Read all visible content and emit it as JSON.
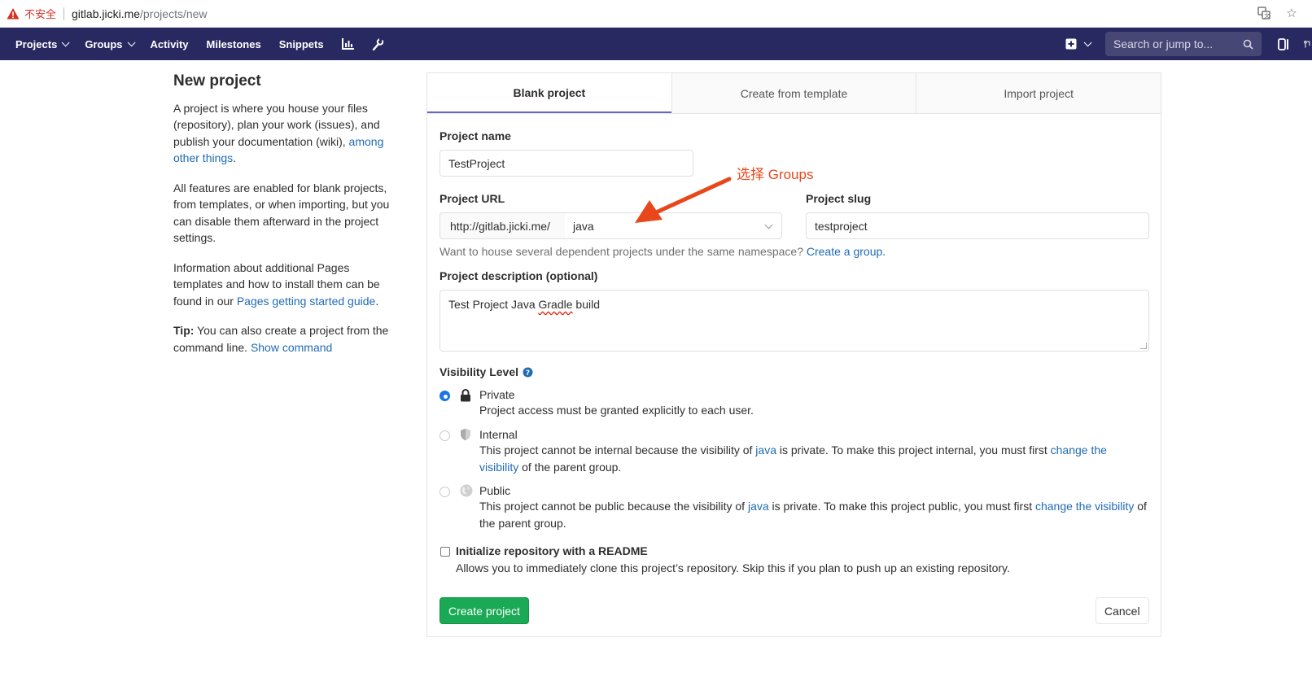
{
  "browser": {
    "insecure_label": "不安全",
    "url_host": "gitlab.jicki.me",
    "url_path": "/projects/new"
  },
  "nav": {
    "items": [
      "Projects",
      "Groups",
      "Activity",
      "Milestones",
      "Snippets"
    ],
    "search_placeholder": "Search or jump to..."
  },
  "sidebar": {
    "title": "New project",
    "para1_text": "A project is where you house your files (repository), plan your work (issues), and publish your documentation (wiki), ",
    "para1_link": "among other things",
    "para1_end": ".",
    "para2": "All features are enabled for blank projects, from templates, or when importing, but you can disable them afterward in the project settings.",
    "para3_text": "Information about additional Pages templates and how to install them can be found in our ",
    "para3_link": "Pages getting started guide",
    "para3_end": ".",
    "tip_label": "Tip:",
    "tip_text": " You can also create a project from the command line. ",
    "tip_link": "Show command"
  },
  "tabs": [
    "Blank project",
    "Create from template",
    "Import project"
  ],
  "form": {
    "project_name_label": "Project name",
    "project_name_value": "TestProject",
    "project_url_label": "Project URL",
    "url_prefix": "http://gitlab.jicki.me/",
    "namespace_value": "java",
    "project_slug_label": "Project slug",
    "project_slug_value": "testproject",
    "namespace_help": "Want to house several dependent projects under the same namespace?",
    "namespace_help_link": "Create a group.",
    "description_label": "Project description (optional)",
    "description_value_a": "Test Project  Java ",
    "description_value_b": "Gradle",
    "description_value_c": " build",
    "visibility_label": "Visibility Level",
    "private_title": "Private",
    "private_desc": "Project access must be granted explicitly to each user.",
    "internal_title": "Internal",
    "internal_desc_a": "This project cannot be internal because the visibility of ",
    "internal_desc_link": "java",
    "internal_desc_b": " is private. To make this project internal, you must first ",
    "internal_desc_link2": "change the visibility",
    "internal_desc_c": " of the parent group.",
    "public_title": "Public",
    "public_desc_a": "This project cannot be public because the visibility of ",
    "public_desc_link": "java",
    "public_desc_b": " is private. To make this project public, you must first ",
    "public_desc_link2": "change the visibility",
    "public_desc_c": " of the parent group.",
    "readme_label": "Initialize repository with a README",
    "readme_help": "Allows you to immediately clone this project’s repository. Skip this if you plan to push up an existing repository.",
    "create_button": "Create project",
    "cancel_button": "Cancel",
    "selected_visibility": "Private"
  },
  "annotation": {
    "text": "选择 Groups",
    "color": "#e8471b"
  },
  "colors": {
    "navbar": "#292961",
    "link": "#1f6bb5",
    "primary_button": "#1aaa55",
    "active_tab_border": "#6666c4"
  }
}
